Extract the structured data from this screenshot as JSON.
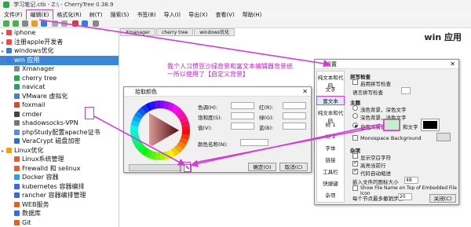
{
  "titlebar": {
    "title": "学习笔记.ctb - Z:\\ - CherryTree 0.38.9"
  },
  "menu": [
    "文件(F)",
    "编辑(E)",
    "格式化(R)",
    "树(T)",
    "搜索(S)",
    "书签(B)",
    "导入(I)",
    "导出(X)",
    "查看(V)",
    "帮助(H)"
  ],
  "tree": [
    {
      "label": "iphone",
      "level": 1,
      "color": "#e05050"
    },
    {
      "label": "注册apple开发者",
      "level": 1,
      "color": "#e05050"
    },
    {
      "label": "windows优化",
      "level": 1,
      "color": "#3a7bd5"
    },
    {
      "label": "win 应用",
      "level": 1,
      "color": "#3a7bd5"
    },
    {
      "label": "Xmanager",
      "level": 2,
      "color": "#8a8a8a"
    },
    {
      "label": "cherry tree",
      "level": 2,
      "color": "#2aa84a"
    },
    {
      "label": "navicat",
      "level": 2,
      "color": "#2a9f6a"
    },
    {
      "label": "VMware 虚拟化",
      "level": 2,
      "color": "#4d7fbf"
    },
    {
      "label": "foxmail",
      "level": 2,
      "color": "#d14b3b"
    },
    {
      "label": "cmder",
      "level": 2,
      "color": "#444444"
    },
    {
      "label": "shadowsocks-VPN",
      "level": 2,
      "color": "#777777"
    },
    {
      "label": "phpStudy配置apache证书",
      "level": 2,
      "color": "#5a8bd6"
    },
    {
      "label": "VeraCrypt 磁盘加密",
      "level": 2,
      "color": "#3a6db8"
    },
    {
      "label": "Linux优化",
      "level": 1,
      "color": "#f0a020"
    },
    {
      "label": "Linux系统管理",
      "level": 2,
      "color": "#e06030"
    },
    {
      "label": "Frewalld 和 selinux",
      "level": 2,
      "color": "#e06030"
    },
    {
      "label": "Docker 容器",
      "level": 2,
      "color": "#3a9ad9"
    },
    {
      "label": "kubernetes 容器编排",
      "level": 2,
      "color": "#3a6bd6"
    },
    {
      "label": "rancher 容器编排管理",
      "level": 2,
      "color": "#3a6bd6"
    },
    {
      "label": "WEB服务",
      "level": 2,
      "color": "#e06030"
    },
    {
      "label": "数据库",
      "level": 2,
      "color": "#3a6bd6"
    },
    {
      "label": "Git",
      "level": 2,
      "color": "#e06030"
    }
  ],
  "tree_selected": 3,
  "tabs": [
    "Xmanager",
    "cherry tree",
    "windows优化"
  ],
  "doc_title": "win 应用",
  "note": "我个人习惯豆沙绿背景和富文本编辑器背景统一所以使用了【自定义背景】",
  "color_dialog": {
    "title": "拾取颜色",
    "hue": "色调(H):",
    "saturation": "饱和度(S):",
    "value": "值(V):",
    "red": "红(R):",
    "green": "绿(G):",
    "blue": "蓝(B):",
    "color_name": "颜色名称(N):",
    "ok": "确定(O)",
    "cancel": "取消(C)"
  },
  "settings_dialog": {
    "title": "设置",
    "sidebar": [
      "纯文本和代码",
      "文字",
      "富文本",
      "纯文本和代码",
      "树 1",
      "树 2",
      "字体",
      "链接",
      "工具栏",
      "快捷键",
      "杂项"
    ],
    "sidebar_selected": 2,
    "spell_header": "拼写检查",
    "spell_check": "启用拼写检查",
    "spell_lang": "语言拼写检查",
    "theme_header": "主题",
    "theme_light": "浅色背景，深色文字",
    "theme_dark": "深色背景，浅色文字",
    "theme_custom": "自定义背景",
    "theme_custom_text": "和文字",
    "monospace_bg": "Monospace Background",
    "misc_header": "杂项",
    "show_whitespace": "显示空白字符",
    "highlight_line": "高亮当前行",
    "code_autoindent": "代码自动缩进",
    "embedded_size": "嵌入文件的图标大小",
    "embedded_size_val": "48",
    "show_filename": "Show File Name on Top of Embedded File Icon",
    "undo_limit": "每个节点最多撤销步数",
    "undo_limit_val": "20",
    "close": "关闭(C)"
  },
  "colors": {
    "accent": "#d43bd4",
    "selection": "#3b86d6",
    "custom_bg": "#c7edcc"
  }
}
